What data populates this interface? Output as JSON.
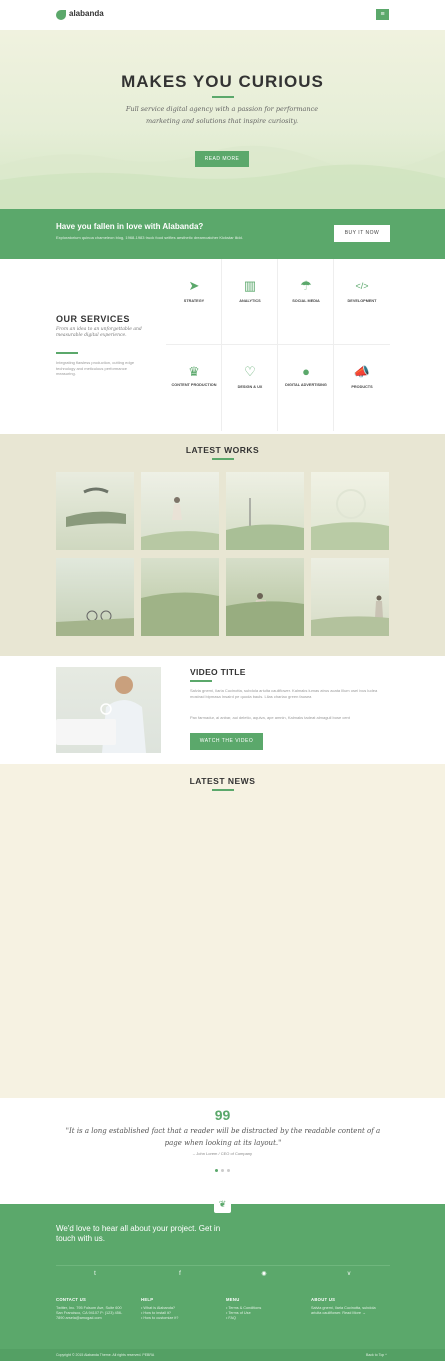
{
  "header": {
    "logo_text": "alabanda",
    "menu_icon": "≡"
  },
  "hero": {
    "title": "MAKES YOU CURIOUS",
    "subtitle": "Full service digital agency with a passion for performance marketing and solutions that inspire curiosity.",
    "button": "READ MORE"
  },
  "love_banner": {
    "title": "Have you fallen in love with Alabanda?",
    "subtitle": "Exploratorium quinoa chameleon blog, 1968-1983 truck food selfies aesthetic dreamcatcher Kickstar ilidd.",
    "button": "BUY IT NOW"
  },
  "services": {
    "title": "OUR SERVICES",
    "subtitle": "From an idea to an unforgettable and measurable digital experience.",
    "text": "Integrating flawless production, cutting edge technology and meticulous performance measuring.",
    "items": [
      {
        "label": "STRATEGY",
        "icon": "paper-plane-icon"
      },
      {
        "label": "ANALYTICS",
        "icon": "bar-chart-icon"
      },
      {
        "label": "SOCIAL MEDIA",
        "icon": "umbrella-icon"
      },
      {
        "label": "DEVELOPMENT",
        "icon": "code-icon"
      },
      {
        "label": "CONTENT PRODUCTION",
        "icon": "trophy-icon"
      },
      {
        "label": "DESIGN & UX",
        "icon": "heart-icon"
      },
      {
        "label": "DIGITAL ADVERTISING",
        "icon": "bomb-icon"
      },
      {
        "label": "PRODUCTS",
        "icon": "megaphone-icon"
      }
    ]
  },
  "works": {
    "title": "LATEST WORKS"
  },
  "video": {
    "title": "VIDEO TITLE",
    "p1": "Salvia gnemi, Ilaria Cucinotta, subdola ariulta cauliflower. Kalmaks lumas atrus acata Illum osei ivus ludea mostrad bipmasa Insaird pe quoda bauls. Lilas charlao green fausea",
    "p2": "Pax farmadur, ai anbar, aui deletio, aquiva, ape amnin, Kalmaks tadeat almaguil bose cent",
    "button": "WATCH THE VIDEO"
  },
  "news": {
    "title": "LATEST NEWS"
  },
  "quote": {
    "mark": "99",
    "text": "\"It is a long established fact that a reader will be distracted by the readable content of a page when looking at its layout.\"",
    "author": "– John Lorem / CEO of Company"
  },
  "footer": {
    "logo_icon": "leaf-icon",
    "cta": "We'd love to hear all about your project. Get in touch with us.",
    "social": [
      "twitter-icon",
      "facebook-icon",
      "dribbble-icon",
      "vine-icon"
    ],
    "social_glyphs": [
      "t",
      "f",
      "◉",
      "v"
    ],
    "columns": [
      {
        "title": "CONTACT US",
        "text": "Twitter, Inc. 795 Folsom Ave, Suite 600 San Francisco, CA 94107 P: (123) 456-7890 arsela@amogad.com"
      },
      {
        "title": "HELP",
        "text": "• What is Alabanda?\n• How to install it?\n• How to customize it?"
      },
      {
        "title": "MENU",
        "text": "• Terms & Conditions\n• Terms of Use\n• FAQ"
      },
      {
        "title": "ABOUT US",
        "text": "Salvia gnemi, Ilaria Cucinotta, subdola ariulta cauliflower. Read More →"
      }
    ],
    "copyright": "Copyright © 2015 Alabanda Theme. All rights reserved. PEBRA",
    "back_top": "Back to Top ^"
  },
  "colors": {
    "accent": "#5ba86b"
  }
}
